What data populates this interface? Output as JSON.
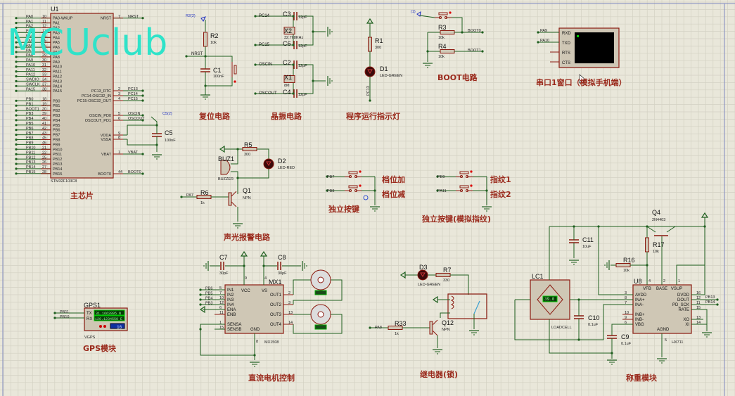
{
  "watermark": "MCUclub",
  "colors": {
    "background": "#e9e7da",
    "grid": "#d3d1c3",
    "wire": "#1f5f1f",
    "component": "#8b1a10",
    "body": "#cfc7b5",
    "title": "#9a2a1c",
    "probe": "#2030c0",
    "watermark": "#2fe3c9"
  },
  "mcu": {
    "ref": "U1",
    "part": "STM32F103C8",
    "title": "主芯片",
    "left_pins": [
      {
        "net": "PA0",
        "num": "10",
        "name": "PA0-WKUP"
      },
      {
        "net": "PA1",
        "num": "11",
        "name": "PA1"
      },
      {
        "net": "PA2",
        "num": "12",
        "name": "PA2"
      },
      {
        "net": "PA3",
        "num": "13",
        "name": "PA3"
      },
      {
        "net": "PA4",
        "num": "14",
        "name": "PA4"
      },
      {
        "net": "PA5",
        "num": "15",
        "name": "PA5"
      },
      {
        "net": "PA6",
        "num": "16",
        "name": "PA6"
      },
      {
        "net": "PA7",
        "num": "17",
        "name": "PA7"
      },
      {
        "net": "PA8",
        "num": "29",
        "name": "PA8"
      },
      {
        "net": "PA9",
        "num": "30",
        "name": "PA9"
      },
      {
        "net": "PA10",
        "num": "31",
        "name": "PA10"
      },
      {
        "net": "PA11",
        "num": "32",
        "name": "PA11"
      },
      {
        "net": "PA12",
        "num": "33",
        "name": "PA12"
      },
      {
        "net": "SWDIO",
        "num": "34",
        "name": "PA13"
      },
      {
        "net": "SWCLK",
        "num": "37",
        "name": "PA14"
      },
      {
        "net": "PA15",
        "num": "38",
        "name": "PA15"
      },
      {
        "net": "PB0",
        "num": "18",
        "name": "PB0"
      },
      {
        "net": "PB1",
        "num": "19",
        "name": "PB1"
      },
      {
        "net": "BOOT1",
        "num": "20",
        "name": "PB2"
      },
      {
        "net": "PB3",
        "num": "39",
        "name": "PB3"
      },
      {
        "net": "PB4",
        "num": "40",
        "name": "PB4"
      },
      {
        "net": "PB5",
        "num": "41",
        "name": "PB5"
      },
      {
        "net": "PB6",
        "num": "42",
        "name": "PB6"
      },
      {
        "net": "PB7",
        "num": "43",
        "name": "PB7"
      },
      {
        "net": "PB8",
        "num": "45",
        "name": "PB8"
      },
      {
        "net": "PB9",
        "num": "46",
        "name": "PB9"
      },
      {
        "net": "PB10",
        "num": "21",
        "name": "PB10"
      },
      {
        "net": "PB11",
        "num": "22",
        "name": "PB11"
      },
      {
        "net": "PB12",
        "num": "25",
        "name": "PB12"
      },
      {
        "net": "PB13",
        "num": "26",
        "name": "PB13"
      },
      {
        "net": "PB14",
        "num": "27",
        "name": "PB14"
      },
      {
        "net": "PB15",
        "num": "28",
        "name": "PB15"
      }
    ],
    "right_pins": [
      {
        "net": "NRST",
        "num": "7",
        "name": "NRST"
      },
      {
        "net": "PC13",
        "num": "2",
        "name": "PC13_RTC"
      },
      {
        "net": "PC14",
        "num": "3",
        "name": "PC14-OSC32_IN"
      },
      {
        "net": "PC15",
        "num": "4",
        "name": "PC15-OSC32_OUT"
      },
      {
        "net": "OSCIN",
        "num": "5",
        "name": "OSCIN_PD0"
      },
      {
        "net": "OSCOUT",
        "num": "6",
        "name": "OSCOUT_PD1"
      },
      {
        "net": "",
        "num": "9",
        "name": "VDDA"
      },
      {
        "net": "",
        "num": "8",
        "name": "VSSA"
      },
      {
        "net": "VBAT",
        "num": "1",
        "name": "VBAT"
      },
      {
        "net": "BOOT0",
        "num": "44",
        "name": "BOOT0"
      }
    ],
    "c5": {
      "ref": "C5",
      "value": "100nF",
      "probe": "C5(2)"
    }
  },
  "reset": {
    "title": "复位电路",
    "probe": "R2(2)",
    "r2": "R2",
    "r2_val": "10k",
    "c1": "C1",
    "c1_val": "100nF",
    "net": "NRST"
  },
  "crystal": {
    "title": "晶振电路",
    "pc14": "PC14",
    "pc15": "PC15",
    "oscin": "OSCIN",
    "oscout": "OSCOUT",
    "c3": "C3",
    "c6": "C6",
    "c2": "C2",
    "c4": "C4",
    "cap_val": "12pF",
    "x2": "X2",
    "x2_val": "32.768KHz",
    "x1": "X1",
    "x1_val": "8M"
  },
  "led": {
    "title": "程序运行指示灯",
    "r1": "R1",
    "r1_val": "300",
    "d1": "D1",
    "d1_val": "LED-GREEN",
    "net": "PC13"
  },
  "boot": {
    "title": "BOOT电路",
    "probe": "(1)",
    "r3": "R3",
    "r4": "R4",
    "r_val": "10k",
    "boot0": "BOOT0",
    "boot1": "BOOT1"
  },
  "terminal": {
    "title": "串口1窗口（模拟手机端）",
    "pa9": "PA9",
    "pa10": "PA10",
    "pins": [
      "RXD",
      "TXD",
      "RTS",
      "CTS"
    ]
  },
  "alarm": {
    "title": "声光报警电路",
    "r5": "R5",
    "r5_val": "300",
    "d2": "D2",
    "d2_val": "LED-RED",
    "buz": "BUZ1",
    "buz_val": "BUZZER",
    "q1": "Q1",
    "q1_val": "NPN",
    "r6": "R6",
    "r6_val": "1k",
    "net": "PA7"
  },
  "keys": {
    "title": "独立按键",
    "pb7": "PB7",
    "pb8": "PB8",
    "k1": "档位加",
    "k2": "档位减"
  },
  "finger": {
    "title": "独立按键(模拟指纹)",
    "pb9": "PB9",
    "pa11": "PA11",
    "k1": "指纹1",
    "k2": "指纹2"
  },
  "motor": {
    "title": "直流电机控制",
    "ref": "MX1",
    "part": "MX1508",
    "c7": "C7",
    "c8": "C8",
    "cap_val": "30pF",
    "vcc": "VCC",
    "vs": "VS",
    "gnd": "GND",
    "in_nets": [
      "PB6",
      "PB5",
      "PB4",
      "PB3"
    ],
    "left_pins": [
      {
        "num": "5",
        "name": "IN1"
      },
      {
        "num": "7",
        "name": "IN2"
      },
      {
        "num": "10",
        "name": "IN3"
      },
      {
        "num": "12",
        "name": "IN4"
      },
      {
        "num": "6",
        "name": "ENA"
      },
      {
        "num": "11",
        "name": "ENB"
      },
      {
        "num": "1",
        "name": "SENSA"
      },
      {
        "num": "15",
        "name": "SENSB"
      }
    ],
    "right_pins": [
      {
        "num": "2",
        "name": "OUT1"
      },
      {
        "num": "3",
        "name": "OUT2"
      },
      {
        "num": "13",
        "name": "OUT3"
      },
      {
        "num": "14",
        "name": "OUT4"
      }
    ],
    "pin_vcc": "9",
    "pin_vs": "4",
    "pin_gnd": "8"
  },
  "relay": {
    "title": "继电器(锁)",
    "d3": "D3",
    "d3_val": "LED-GREEN",
    "r7": "R7",
    "r7_val": "330",
    "q12": "Q12",
    "q12_val": "NPN",
    "r33": "R33",
    "r33_val": "1k",
    "net": "PA8"
  },
  "weigh": {
    "title": "称重模块",
    "q4": "Q4",
    "q4_val": "2N4403",
    "c11": "C11",
    "c11_val": "10uF",
    "r17": "R17",
    "r17_val": "10k",
    "r16": "R16",
    "r16_val": "10k",
    "lc": "LC1",
    "lc_val": "LOADCELL",
    "lc_display": "39.0",
    "u8": "U8",
    "u8_part": "HX711",
    "c10": "C10",
    "c10_val": "0.1uF",
    "c9": "C9",
    "c9_val": "0.1uF",
    "top_pins": [
      {
        "num": "4",
        "name": "VFB"
      },
      {
        "num": "2",
        "name": "BASE"
      },
      {
        "num": "1",
        "name": "VSUP"
      }
    ],
    "left_pins": [
      {
        "num": "3",
        "name": "AVDD"
      },
      {
        "num": "8",
        "name": "INA+"
      },
      {
        "num": "7",
        "name": "INA-"
      },
      {
        "num": "10",
        "name": "INB+"
      },
      {
        "num": "9",
        "name": "INB-"
      },
      {
        "num": "6",
        "name": "VBG"
      }
    ],
    "right_pins": [
      {
        "num": "16",
        "name": "DVDD"
      },
      {
        "num": "12",
        "name": "DOUT"
      },
      {
        "num": "11",
        "name": "PD_SCK"
      },
      {
        "num": "15",
        "name": "RATE"
      },
      {
        "num": "13",
        "name": "XO"
      },
      {
        "num": "14",
        "name": "XI"
      }
    ],
    "agnd": "AGND",
    "agnd_num": "5",
    "pb13": "PB13",
    "pb14": "PB14"
  },
  "gps": {
    "title": "GPS模块",
    "ref": "GPS1",
    "part": "VGPS",
    "tx": "TX",
    "rx": "RX",
    "lat": "31.1662895 N",
    "lon": "120.1234550 E",
    "sats": "16",
    "pb11": "PB11",
    "pb10": "PB10"
  }
}
